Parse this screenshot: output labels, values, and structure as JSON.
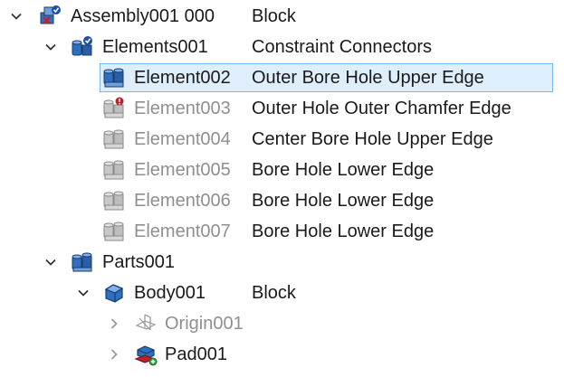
{
  "tree": {
    "rows": [
      {
        "label": "Assembly001 000",
        "description": "Block",
        "icon": "assembly-icon",
        "toggle": "expanded"
      },
      {
        "label": "Elements001",
        "description": "Constraint Connectors",
        "icon": "elements-group-icon",
        "toggle": "expanded"
      },
      {
        "label": "Element002",
        "description": "Outer Bore Hole Upper Edge",
        "icon": "element-active-icon",
        "selected": true
      },
      {
        "label": "Element003",
        "description": "Outer Hole Outer Chamfer Edge",
        "icon": "element-error-icon"
      },
      {
        "label": "Element004",
        "description": "Center Bore Hole Upper Edge",
        "icon": "element-hidden-icon"
      },
      {
        "label": "Element005",
        "description": "Bore Hole Lower Edge",
        "icon": "element-hidden-icon"
      },
      {
        "label": "Element006",
        "description": "Bore Hole Lower Edge",
        "icon": "element-hidden-icon"
      },
      {
        "label": "Element007",
        "description": "Bore Hole Lower Edge",
        "icon": "element-hidden-icon"
      },
      {
        "label": "Parts001",
        "description": "",
        "icon": "parts-group-icon",
        "toggle": "expanded"
      },
      {
        "label": "Body001",
        "description": "Block",
        "icon": "body-icon",
        "toggle": "expanded"
      },
      {
        "label": "Origin001",
        "description": "",
        "icon": "origin-icon",
        "toggle": "collapsed"
      },
      {
        "label": "Pad001",
        "description": "",
        "icon": "pad-icon",
        "toggle": "collapsed"
      }
    ]
  },
  "colors": {
    "selection_bg": "#dfeefb",
    "selection_border": "#7bb8ea",
    "dim_text": "#8f8f8f"
  }
}
